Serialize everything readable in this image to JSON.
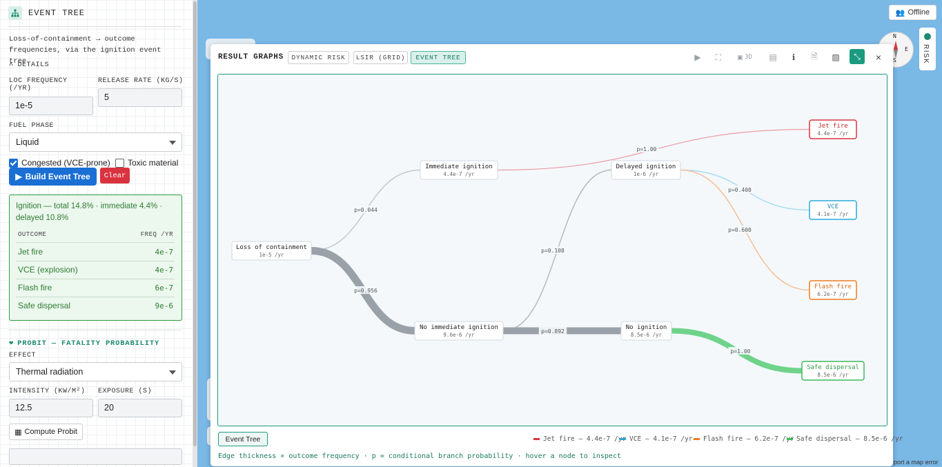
{
  "panel": {
    "title": "EVENT TREE",
    "description": "Loss-of-containment → outcome frequencies, via the ignition event tree.",
    "details_toggle": "DETAILS",
    "loc_freq_label": "LOC FREQUENCY (/YR)",
    "loc_freq_value": "1e-5",
    "release_rate_label": "RELEASE RATE (KG/S)",
    "release_rate_value": "5",
    "fuel_phase_label": "FUEL PHASE",
    "fuel_phase_value": "Liquid",
    "congested_label": "Congested (VCE-prone)",
    "congested_checked": true,
    "toxic_label": "Toxic material",
    "toxic_checked": false,
    "build_label": "Build Event Tree",
    "clear_label": "Clear",
    "summary": "Ignition — total 14.8% · immediate 4.4% · delayed 10.8%",
    "col_outcome": "OUTCOME",
    "col_freq": "FREQ /YR",
    "outcomes": [
      {
        "name": "Jet fire",
        "freq": "4e-7"
      },
      {
        "name": "VCE (explosion)",
        "freq": "4e-7"
      },
      {
        "name": "Flash fire",
        "freq": "6e-7"
      },
      {
        "name": "Safe dispersal",
        "freq": "9e-6"
      }
    ],
    "probit_title": "PROBIT — FATALITY PROBABILITY",
    "effect_label": "EFFECT",
    "effect_value": "Thermal radiation",
    "intensity_label": "INTENSITY (KW/M²)",
    "intensity_value": "12.5",
    "exposure_label": "EXPOSURE (S)",
    "exposure_value": "20",
    "compute_label": "Compute Probit"
  },
  "map": {
    "offline_label": "Offline",
    "risk_label": "RISK",
    "compass_n": "N",
    "compass_e": "E",
    "compass_s": "S",
    "attribution": "eport a map error"
  },
  "modal": {
    "title": "RESULT GRAPHS",
    "tabs": [
      "DYNAMIC RISK",
      "LSIR (GRID)",
      "EVENT TREE"
    ],
    "active_tab": 2,
    "view3d_label": "3D",
    "bottom_tab": "Event Tree",
    "legend": [
      {
        "label": "Jet fire — 4.4e-7 /yr",
        "color": "#d9333f"
      },
      {
        "label": "VCE — 4.1e-7 /yr",
        "color": "#2aa8d8"
      },
      {
        "label": "Flash fire — 6.2e-7 /yr",
        "color": "#f07a1e"
      },
      {
        "label": "Safe dispersal — 8.5e-6 /yr",
        "color": "#3cb95a"
      }
    ],
    "footnote": "Edge thickness ∝ outcome frequency · p = conditional branch probability · hover a node to inspect"
  },
  "tree": {
    "nodes": [
      {
        "id": "loc",
        "title": "Loss of containment",
        "freq": "1e-5 /yr"
      },
      {
        "id": "imm",
        "title": "Immediate ignition",
        "freq": "4.4e-7 /yr"
      },
      {
        "id": "noimm",
        "title": "No immediate ignition",
        "freq": "9.6e-6 /yr"
      },
      {
        "id": "del",
        "title": "Delayed ignition",
        "freq": "1e-6 /yr"
      },
      {
        "id": "noig",
        "title": "No ignition",
        "freq": "8.5e-6 /yr"
      },
      {
        "id": "jet",
        "title": "Jet fire",
        "freq": "4.4e-7 /yr"
      },
      {
        "id": "vce",
        "title": "VCE",
        "freq": "4.1e-7 /yr"
      },
      {
        "id": "flash",
        "title": "Flash fire",
        "freq": "6.2e-7 /yr"
      },
      {
        "id": "safe",
        "title": "Safe dispersal",
        "freq": "8.5e-6 /yr"
      }
    ],
    "edges": [
      {
        "from": "loc",
        "to": "imm",
        "p": "p=0.044"
      },
      {
        "from": "loc",
        "to": "noimm",
        "p": "p=0.956"
      },
      {
        "from": "imm",
        "to": "jet",
        "p": "p=1.00"
      },
      {
        "from": "noimm",
        "to": "del",
        "p": "p=0.108"
      },
      {
        "from": "noimm",
        "to": "noig",
        "p": "p=0.892"
      },
      {
        "from": "del",
        "to": "vce",
        "p": "p=0.400"
      },
      {
        "from": "del",
        "to": "flash",
        "p": "p=0.600"
      },
      {
        "from": "noig",
        "to": "safe",
        "p": "p=1.00"
      }
    ]
  }
}
